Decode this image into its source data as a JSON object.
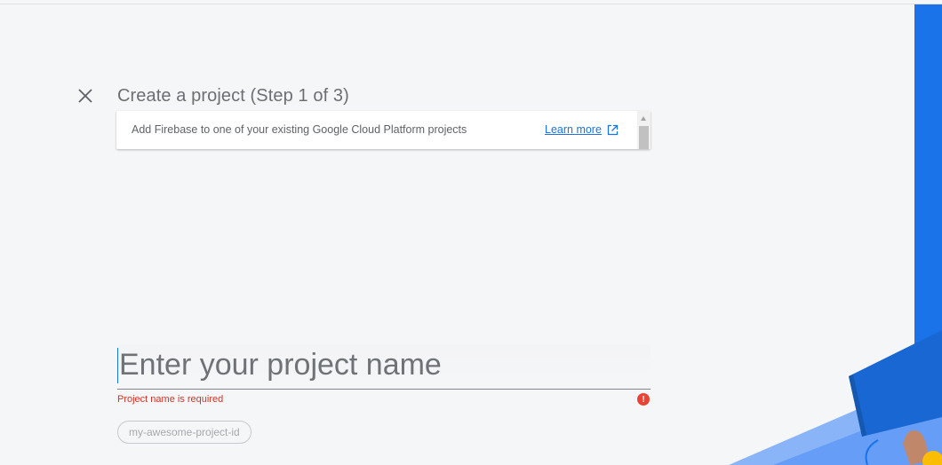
{
  "header": {
    "title": "Create a project (Step 1 of 3)"
  },
  "icons": {
    "close": "close-icon",
    "external_link": "open-in-new-icon",
    "error": "error-icon"
  },
  "info_card": {
    "text": "Add Firebase to one of your existing Google Cloud Platform projects",
    "link_label": "Learn more"
  },
  "project_form": {
    "name_value": "",
    "name_placeholder": "Enter your project name",
    "error_message": "Project name is required",
    "error_icon_glyph": "!",
    "project_id_chip": "my-awesome-project-id"
  },
  "colors": {
    "accent": "#1a73e8",
    "error": "#d93025",
    "background": "#f5f6f8"
  }
}
